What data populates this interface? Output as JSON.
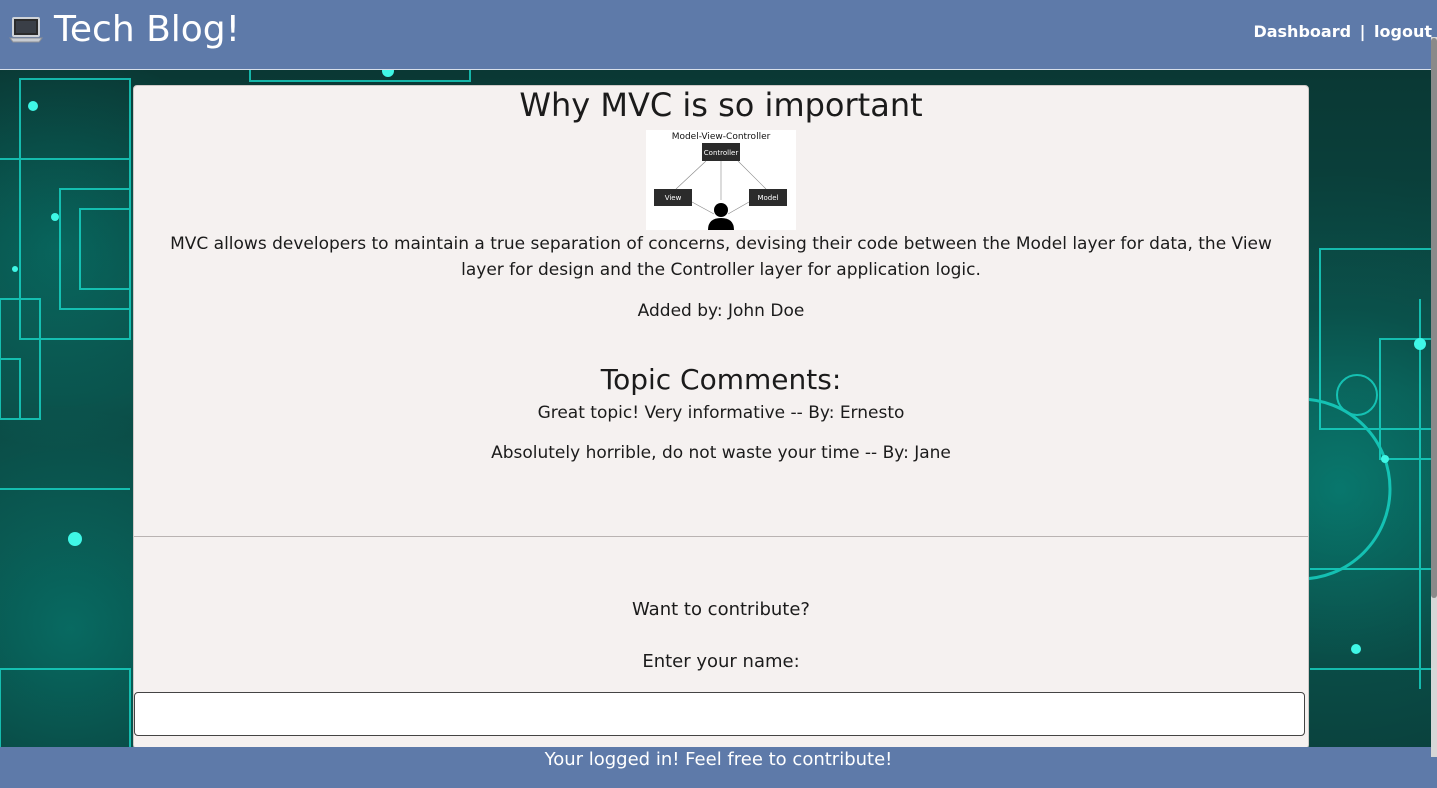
{
  "header": {
    "brand_icon": "laptop-icon",
    "title": "Tech Blog!",
    "nav": {
      "dashboard": "Dashboard",
      "separator": "|",
      "logout": "logout"
    }
  },
  "post": {
    "title": "Why MVC is so important",
    "image": {
      "heading": "Model-View-Controller",
      "controller": "Controller",
      "view": "View",
      "model": "Model"
    },
    "body": "MVC allows developers to maintain a true separation of concerns, devising their code between the Model layer for data, the View layer for design and the Controller layer for application logic.",
    "added_by": "Added by: John Doe"
  },
  "comments": {
    "title": "Topic Comments:",
    "items": [
      {
        "text": "Great topic! Very informative -- By: Ernesto"
      },
      {
        "text": "Absolutely horrible, do not waste your time -- By: Jane"
      }
    ]
  },
  "contribute": {
    "prompt": "Want to contribute?",
    "name_label": "Enter your name:",
    "name_value": ""
  },
  "footer": {
    "text": "Your logged in! Feel free to contribute!"
  },
  "colors": {
    "header_bg": "#5e7aa9",
    "card_bg": "#f5f1f0",
    "accent_cyan": "#00e6d2"
  }
}
